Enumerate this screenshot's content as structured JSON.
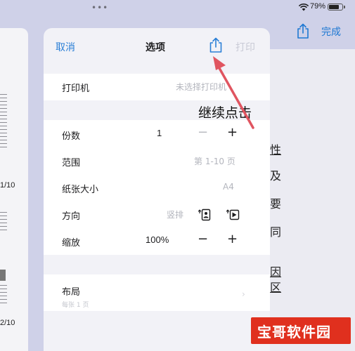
{
  "status_bar": {
    "dots": "•••",
    "battery_text": "79%",
    "battery_level": 0.79
  },
  "header": {
    "done_label": "完成",
    "share_icon": "share-icon"
  },
  "left_thumbnails": [
    {
      "label": "1/10"
    },
    {
      "label": "2/10"
    }
  ],
  "right_page_chars": [
    "性",
    "及",
    "要",
    "同",
    "因",
    "区"
  ],
  "panel": {
    "cancel_label": "取消",
    "title": "选项",
    "print_label": "打印",
    "share_icon": "share-icon",
    "printer": {
      "label": "打印机",
      "value": "未选择打印机"
    },
    "copies": {
      "label": "份数",
      "value": "1",
      "minus": "−",
      "plus": "+"
    },
    "range": {
      "label": "范围",
      "value": "第 1-10 页"
    },
    "paper_size": {
      "label": "纸张大小",
      "value": "A4"
    },
    "orientation": {
      "label": "方向",
      "value": "竖排",
      "portrait_icon": "portrait-orientation-icon",
      "landscape_icon": "landscape-orientation-icon"
    },
    "scale": {
      "label": "缩放",
      "value": "100%",
      "minus": "−",
      "plus": "+"
    },
    "layout": {
      "label": "布局",
      "sublabel": "每张 1 页"
    }
  },
  "annotation": {
    "text": "继续点击",
    "color": "#e05560"
  },
  "watermark": {
    "text": "宝哥软件园",
    "color": "#e0301e"
  },
  "colors": {
    "accent": "#2a7fd6",
    "panel_bg": "#f2f2f7",
    "page_bg": "#cfd1e8"
  }
}
